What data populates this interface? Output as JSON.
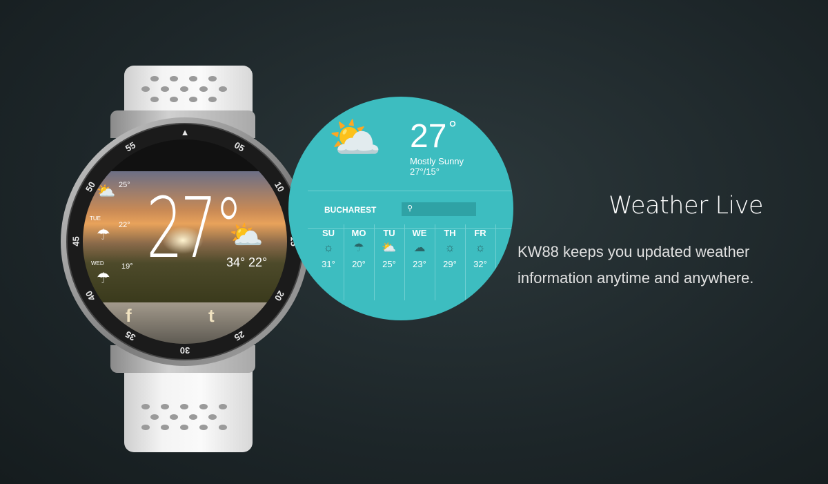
{
  "heading": "Weather Live",
  "description": [
    "KW88 keeps you updated weather",
    "information anytime and anywhere."
  ],
  "colors": {
    "teal": "#3dbdc0",
    "background": "#1d2629"
  },
  "watch": {
    "bezel_labels": [
      "55",
      "05",
      "10",
      "15",
      "20",
      "25",
      "30",
      "35",
      "40",
      "45",
      "50"
    ],
    "bezel_marker": "▲",
    "screen": {
      "temp": "27°",
      "high_low": [
        "34°",
        "22°"
      ],
      "side": [
        {
          "day": "",
          "temp": "25°",
          "icon": "partly-cloudy"
        },
        {
          "day": "TUE",
          "temp": "22°",
          "icon": "rain"
        },
        {
          "day": "WED",
          "temp": "19°",
          "icon": "rain"
        }
      ],
      "social": [
        "f",
        "t"
      ]
    }
  },
  "weather_card": {
    "temp": "27",
    "degree": "°",
    "condition": "Mostly Sunny",
    "range": "27°/15°",
    "city": "BUCHAREST",
    "search_icon": "search-icon",
    "days": [
      {
        "d": "SU",
        "t": "31°",
        "icon": "☼"
      },
      {
        "d": "MO",
        "t": "20°",
        "icon": "☂"
      },
      {
        "d": "TU",
        "t": "25°",
        "icon": "⛅"
      },
      {
        "d": "WE",
        "t": "23°",
        "icon": "☁"
      },
      {
        "d": "TH",
        "t": "29°",
        "icon": "☼"
      },
      {
        "d": "FR",
        "t": "32°",
        "icon": "☼"
      }
    ]
  }
}
